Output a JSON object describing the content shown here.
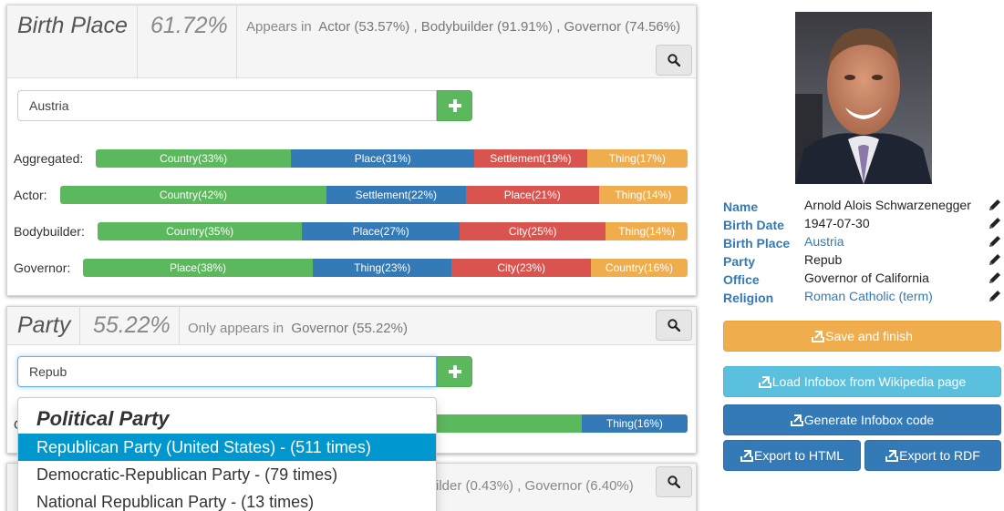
{
  "birth_place_panel": {
    "title": "Birth Place",
    "percent": "61.72%",
    "appears_label": "Appears in",
    "appears_values": "Actor (53.57%) , Bodybuilder (91.91%) , Governor (74.56%)",
    "input_value": "Austria",
    "rows": [
      {
        "label": "Aggregated:",
        "segments": [
          {
            "text": "Country(33%)",
            "share": 33,
            "color": "#5cb85c"
          },
          {
            "text": "Place(31%)",
            "share": 31,
            "color": "#337ab7"
          },
          {
            "text": "Settlement(19%)",
            "share": 19,
            "color": "#d9534f"
          },
          {
            "text": "Thing(17%)",
            "share": 17,
            "color": "#f0ad4e"
          }
        ]
      },
      {
        "label": "Actor:",
        "segments": [
          {
            "text": "Country(42%)",
            "share": 42,
            "color": "#5cb85c"
          },
          {
            "text": "Settlement(22%)",
            "share": 22,
            "color": "#337ab7"
          },
          {
            "text": "Place(21%)",
            "share": 21,
            "color": "#d9534f"
          },
          {
            "text": "Thing(14%)",
            "share": 14,
            "color": "#f0ad4e"
          }
        ]
      },
      {
        "label": "Bodybuilder:",
        "segments": [
          {
            "text": "Country(35%)",
            "share": 35,
            "color": "#5cb85c"
          },
          {
            "text": "Place(27%)",
            "share": 27,
            "color": "#337ab7"
          },
          {
            "text": "City(25%)",
            "share": 25,
            "color": "#d9534f"
          },
          {
            "text": "Thing(14%)",
            "share": 14,
            "color": "#f0ad4e"
          }
        ]
      },
      {
        "label": "Governor:",
        "segments": [
          {
            "text": "Place(38%)",
            "share": 38,
            "color": "#5cb85c"
          },
          {
            "text": "Thing(23%)",
            "share": 23,
            "color": "#337ab7"
          },
          {
            "text": "City(23%)",
            "share": 23,
            "color": "#d9534f"
          },
          {
            "text": "Country(16%)",
            "share": 16,
            "color": "#f0ad4e"
          }
        ]
      }
    ]
  },
  "party_panel": {
    "title": "Party",
    "percent": "55.22%",
    "appears_label": "Only appears in",
    "appears_values": "Governor (55.22%)",
    "input_value": "Repub",
    "partial_row_label": "G",
    "partial_row_segments": [
      {
        "text": "",
        "share": 84,
        "color": "#5cb85c"
      },
      {
        "text": "Thing(16%)",
        "share": 16,
        "color": "#337ab7"
      }
    ]
  },
  "third_panel": {
    "appears_values": "ilder (0.43%) , Governor (6.40%)"
  },
  "autocomplete": {
    "header": "Political Party",
    "items": [
      "Republican Party (United States) - (511 times)",
      "Democratic-Republican Party - (79 times)",
      "National Republican Party - (13 times)"
    ],
    "active_index": 0
  },
  "infobox": {
    "fields": [
      {
        "key": "Name",
        "value": "Arnold Alois Schwarzenegger",
        "link": false
      },
      {
        "key": "Birth Date",
        "value": "1947-07-30",
        "link": false
      },
      {
        "key": "Birth Place",
        "value": "Austria",
        "link": true
      },
      {
        "key": "Party",
        "value": "Repub",
        "link": false
      },
      {
        "key": "Office",
        "value": "Governor of California",
        "link": false
      },
      {
        "key": "Religion",
        "value": "Roman Catholic (term)",
        "link": true
      }
    ]
  },
  "actions": {
    "save": "Save and finish",
    "load": "Load Infobox from Wikipedia page",
    "generate": "Generate Infobox code",
    "export_html": "Export to HTML",
    "export_rdf": "Export to RDF"
  },
  "colors": {
    "green": "#5cb85c",
    "blue": "#337ab7",
    "red": "#d9534f",
    "orange": "#f0ad4e",
    "info": "#5bc0de",
    "warning": "#f0ad4e"
  }
}
